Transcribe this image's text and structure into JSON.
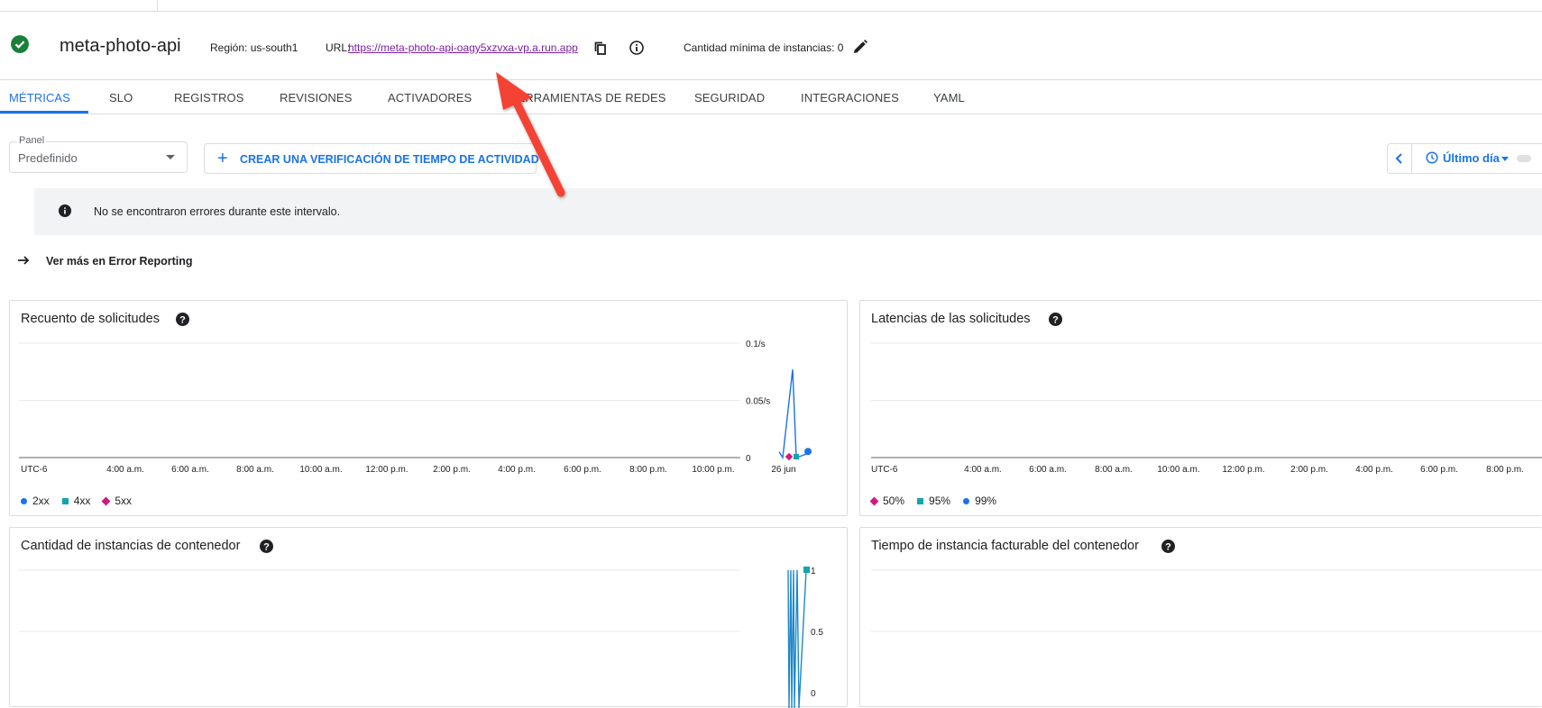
{
  "header": {
    "service_name": "meta-photo-api",
    "region": "Región: us-south1",
    "url_label": "URL:",
    "url": "https://meta-photo-api-oagy5xzvxa-vp.a.run.app",
    "min_instances": "Cantidad mínima de instancias: 0",
    "icons": [
      "check-circle-icon",
      "copy-icon",
      "info-icon",
      "pencil-icon"
    ]
  },
  "tabs": [
    {
      "label": "MÉTRICAS",
      "active": true
    },
    {
      "label": "SLO"
    },
    {
      "label": "REGISTROS"
    },
    {
      "label": "REVISIONES"
    },
    {
      "label": "ACTIVADORES"
    },
    {
      "label": "HERRAMIENTAS DE REDES"
    },
    {
      "label": "SEGURIDAD"
    },
    {
      "label": "INTEGRACIONES"
    },
    {
      "label": "YAML"
    }
  ],
  "toolbar": {
    "panel_label": "Panel",
    "panel_value": "Predefinido",
    "create_uptime_check": "CREAR UNA VERIFICACIÓN DE TIEMPO DE ACTIVIDAD",
    "time_range": "Último día"
  },
  "banner": {
    "text": "No se encontraron errores durante este intervalo."
  },
  "error_reporting_link": "Ver más en Error Reporting",
  "colors": {
    "accent": "#1a73e8",
    "success": "#188038",
    "link_visited": "#7b1fa2",
    "series_2xx": "#1a73e8",
    "series_4xx": "#12a4af",
    "series_5xx": "#d01884",
    "annotation_arrow": "#f44336"
  },
  "cards": {
    "request_count": {
      "title": "Recuento de solicitudes",
      "legend": [
        "2xx",
        "4xx",
        "5xx"
      ]
    },
    "request_latency": {
      "title": "Latencias de las solicitudes",
      "legend": [
        "50%",
        "95%",
        "99%"
      ]
    },
    "container_instances": {
      "title": "Cantidad de instancias de contenedor"
    },
    "billable_time": {
      "title": "Tiempo de instancia facturable del contenedor"
    }
  },
  "chart_data": [
    {
      "type": "line",
      "title": "Recuento de solicitudes",
      "x_tick_labels": [
        "UTC-6",
        "4:00 a.m.",
        "6:00 a.m.",
        "8:00 a.m.",
        "10:00 a.m.",
        "12:00 p.m.",
        "2:00 p.m.",
        "4:00 p.m.",
        "6:00 p.m.",
        "8:00 p.m.",
        "10:00 p.m.",
        "26 jun"
      ],
      "y_tick_labels": [
        "0.1/s",
        "0.05/s",
        "0"
      ],
      "ylim": [
        0,
        0.1
      ],
      "series": [
        {
          "name": "2xx",
          "x": [
            "25 jun 11:20 p.m.",
            "25 jun 11:30 p.m.",
            "25 jun 11:40 p.m.",
            "25 jun 11:50 p.m.",
            "26 jun 12:00 a.m."
          ],
          "values": [
            0.005,
            0.0,
            0.077,
            0.0,
            0.003
          ]
        },
        {
          "name": "4xx",
          "x": [
            "26 jun 12:00 a.m."
          ],
          "values": [
            0.0
          ]
        },
        {
          "name": "5xx",
          "x": [
            "25 jun 11:50 p.m."
          ],
          "values": [
            0.0
          ]
        }
      ]
    },
    {
      "type": "line",
      "title": "Latencias de las solicitudes",
      "x_tick_labels": [
        "UTC-6",
        "4:00 a.m.",
        "6:00 a.m.",
        "8:00 a.m.",
        "10:00 a.m.",
        "12:00 p.m.",
        "2:00 p.m.",
        "4:00 p.m.",
        "6:00 p.m.",
        "8:00 p.m."
      ],
      "series": [
        {
          "name": "50%",
          "values": []
        },
        {
          "name": "95%",
          "values": []
        },
        {
          "name": "99%",
          "values": []
        }
      ]
    },
    {
      "type": "line",
      "title": "Cantidad de instancias de contenedor",
      "y_tick_labels": [
        "1",
        "0.5",
        "0"
      ],
      "ylim": [
        0,
        1
      ],
      "series": [
        {
          "name": "",
          "values": [
            1,
            0,
            1,
            0,
            1,
            0,
            1,
            0,
            1
          ]
        }
      ]
    },
    {
      "type": "line",
      "title": "Tiempo de instancia facturable del contenedor",
      "series": []
    }
  ]
}
